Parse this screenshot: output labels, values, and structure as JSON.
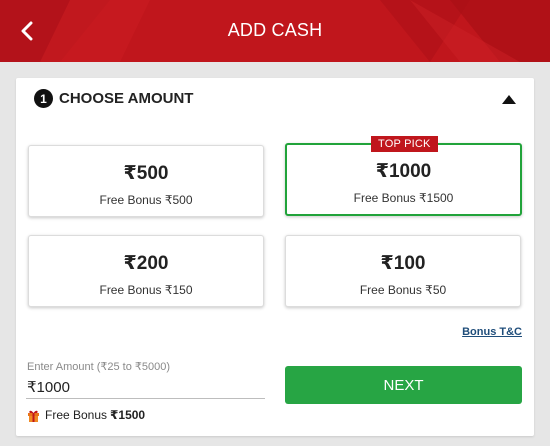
{
  "header": {
    "title": "ADD CASH",
    "back_icon": "chevron-left-icon"
  },
  "section": {
    "step_number": "1",
    "title": "CHOOSE AMOUNT",
    "collapse_icon": "caret-up-icon"
  },
  "amounts": [
    {
      "value": "₹500",
      "bonus": "Free Bonus ₹500",
      "selected": false
    },
    {
      "value": "₹1000",
      "bonus": "Free Bonus ₹1500",
      "selected": true,
      "badge": "TOP PICK"
    },
    {
      "value": "₹200",
      "bonus": "Free Bonus ₹150",
      "selected": false
    },
    {
      "value": "₹100",
      "bonus": "Free Bonus ₹50",
      "selected": false
    }
  ],
  "bonus_tnc": "Bonus T&C",
  "input": {
    "label": "Enter Amount (₹25 to ₹5000)",
    "value": "₹1000"
  },
  "bonus_summary": {
    "label": "Free Bonus",
    "value": "₹1500",
    "icon": "gift-icon"
  },
  "next_label": "NEXT",
  "colors": {
    "header_red": "#c0161c",
    "selected_green": "#21a33a",
    "next_green": "#27a544",
    "link_blue": "#1f4d7a"
  }
}
